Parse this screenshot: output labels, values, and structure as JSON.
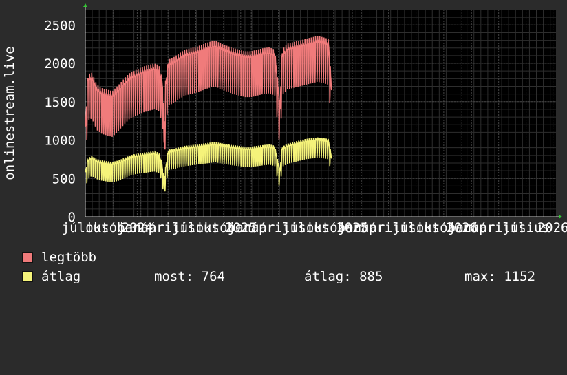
{
  "chart_data": {
    "type": "line",
    "ylabel": "onlinestream.live",
    "ylim": [
      0,
      2700
    ],
    "y_ticks": [
      "0",
      "500",
      "1000",
      "1500",
      "2000",
      "2500"
    ],
    "y_tick_values": [
      0,
      500,
      1000,
      1500,
      2000,
      2500
    ],
    "x_ticks": [
      "július",
      "október",
      "2024",
      "január",
      "április",
      "július",
      "október",
      "2025",
      "január",
      "április",
      "július",
      "október",
      "2025",
      "január",
      "április",
      "július",
      "október",
      "2026",
      "január",
      "április",
      "július",
      "2026"
    ],
    "x_tick_days": [
      0,
      92,
      172,
      184,
      274,
      366,
      458,
      515,
      550,
      640,
      731,
      823,
      885,
      915,
      1005,
      1096,
      1188,
      1248,
      1280,
      1370,
      1461,
      1550
    ],
    "x_range_days": [
      0,
      1560
    ],
    "grid": true,
    "background": "#000000",
    "grid_color": "#444444",
    "series": [
      {
        "name": "legtöbb",
        "color": "#f07b7b",
        "points": [
          [
            0,
            1100
          ],
          [
            8,
            1780
          ],
          [
            22,
            1800
          ],
          [
            38,
            1650
          ],
          [
            55,
            1600
          ],
          [
            72,
            1580
          ],
          [
            90,
            1560
          ],
          [
            110,
            1640
          ],
          [
            128,
            1720
          ],
          [
            145,
            1790
          ],
          [
            160,
            1820
          ],
          [
            175,
            1850
          ],
          [
            192,
            1880
          ],
          [
            210,
            1900
          ],
          [
            228,
            1920
          ],
          [
            244,
            1900
          ],
          [
            253,
            1760
          ],
          [
            258,
            1640
          ],
          [
            261,
            940
          ],
          [
            266,
            1700
          ],
          [
            275,
            1970
          ],
          [
            292,
            2000
          ],
          [
            310,
            2050
          ],
          [
            330,
            2100
          ],
          [
            350,
            2120
          ],
          [
            370,
            2140
          ],
          [
            390,
            2170
          ],
          [
            410,
            2200
          ],
          [
            430,
            2220
          ],
          [
            450,
            2180
          ],
          [
            470,
            2150
          ],
          [
            490,
            2120
          ],
          [
            510,
            2100
          ],
          [
            530,
            2080
          ],
          [
            550,
            2080
          ],
          [
            570,
            2100
          ],
          [
            590,
            2120
          ],
          [
            610,
            2130
          ],
          [
            628,
            2100
          ],
          [
            638,
            1700
          ],
          [
            645,
            1400
          ],
          [
            652,
            2100
          ],
          [
            670,
            2180
          ],
          [
            690,
            2200
          ],
          [
            710,
            2220
          ],
          [
            730,
            2240
          ],
          [
            750,
            2260
          ],
          [
            770,
            2280
          ],
          [
            790,
            2260
          ],
          [
            806,
            2240
          ],
          [
            816,
            1650
          ]
        ]
      },
      {
        "name": "átlag",
        "color": "#f5f37a",
        "points": [
          [
            0,
            560
          ],
          [
            8,
            730
          ],
          [
            22,
            760
          ],
          [
            38,
            720
          ],
          [
            55,
            700
          ],
          [
            72,
            690
          ],
          [
            90,
            680
          ],
          [
            110,
            700
          ],
          [
            128,
            730
          ],
          [
            145,
            760
          ],
          [
            160,
            780
          ],
          [
            175,
            790
          ],
          [
            192,
            800
          ],
          [
            210,
            810
          ],
          [
            228,
            820
          ],
          [
            244,
            800
          ],
          [
            253,
            700
          ],
          [
            258,
            560
          ],
          [
            261,
            470
          ],
          [
            266,
            620
          ],
          [
            275,
            840
          ],
          [
            292,
            850
          ],
          [
            310,
            870
          ],
          [
            330,
            890
          ],
          [
            350,
            900
          ],
          [
            370,
            910
          ],
          [
            390,
            920
          ],
          [
            410,
            930
          ],
          [
            430,
            940
          ],
          [
            450,
            925
          ],
          [
            470,
            910
          ],
          [
            490,
            900
          ],
          [
            510,
            890
          ],
          [
            530,
            880
          ],
          [
            550,
            880
          ],
          [
            570,
            890
          ],
          [
            590,
            900
          ],
          [
            610,
            910
          ],
          [
            628,
            890
          ],
          [
            638,
            700
          ],
          [
            645,
            590
          ],
          [
            652,
            880
          ],
          [
            670,
            920
          ],
          [
            690,
            940
          ],
          [
            710,
            960
          ],
          [
            730,
            980
          ],
          [
            750,
            990
          ],
          [
            770,
            1000
          ],
          [
            790,
            990
          ],
          [
            806,
            980
          ],
          [
            816,
            760
          ]
        ]
      }
    ]
  },
  "legend": {
    "items": [
      {
        "label": "legtöbb",
        "color": "#f07b7b"
      },
      {
        "label": "átlag",
        "color": "#f5f37a"
      }
    ],
    "stats": {
      "now": "most: 764",
      "avg": "átlag: 885",
      "max": "max: 1152"
    }
  }
}
